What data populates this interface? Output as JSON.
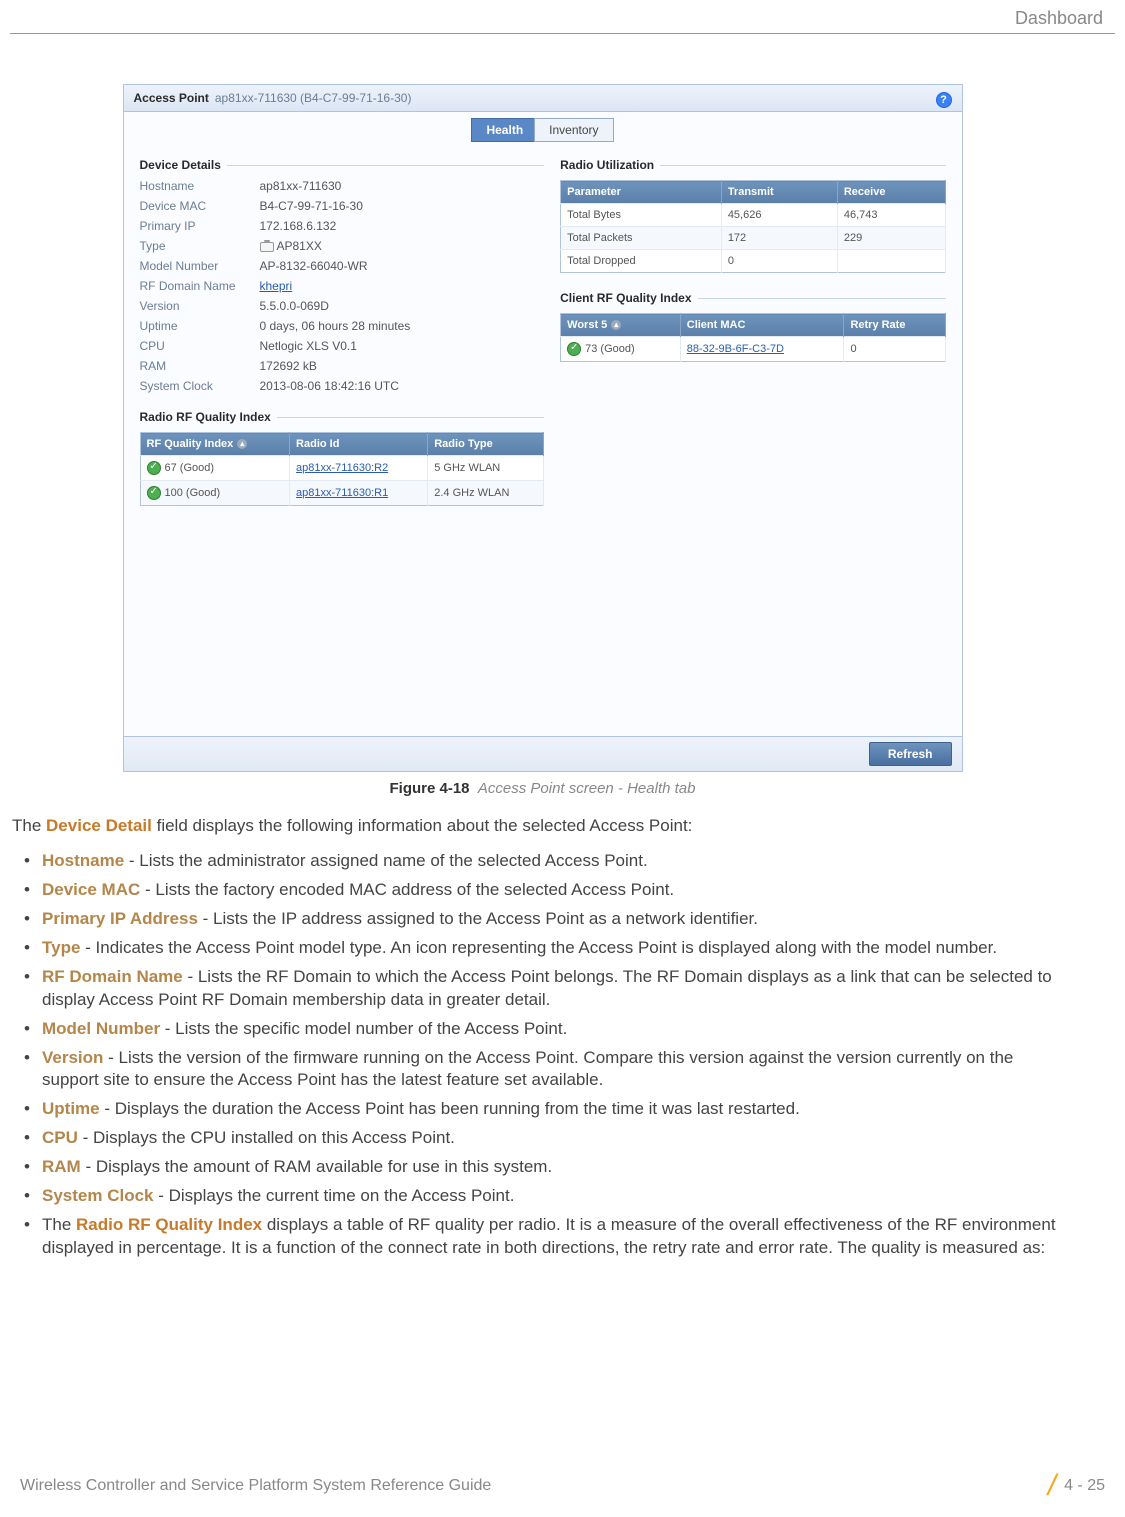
{
  "header_crumb": "Dashboard",
  "page_number": "4 - 25",
  "footer_text": "Wireless Controller and Service Platform System Reference Guide",
  "figure": {
    "num": "Figure 4-18",
    "caption": "Access Point screen - Health tab"
  },
  "panel": {
    "title": "Access Point",
    "subtitle": "ap81xx-711630 (B4-C7-99-71-16-30)",
    "tabs": {
      "health": "Health",
      "inventory": "Inventory"
    },
    "refresh": "Refresh",
    "device_details": {
      "legend": "Device Details",
      "rows": [
        {
          "k": "Hostname",
          "v": "ap81xx-711630"
        },
        {
          "k": "Device MAC",
          "v": "B4-C7-99-71-16-30"
        },
        {
          "k": "Primary IP",
          "v": "172.168.6.132"
        },
        {
          "k": "Type",
          "v": "AP81XX",
          "icon": true
        },
        {
          "k": "Model Number",
          "v": "AP-8132-66040-WR"
        },
        {
          "k": "RF Domain Name",
          "v": "khepri",
          "link": true
        },
        {
          "k": "Version",
          "v": "5.5.0.0-069D"
        },
        {
          "k": "Uptime",
          "v": "0 days, 06 hours 28 minutes"
        },
        {
          "k": "CPU",
          "v": "Netlogic XLS V0.1"
        },
        {
          "k": "RAM",
          "v": "172692 kB"
        },
        {
          "k": "System Clock",
          "v": "2013-08-06 18:42:16 UTC"
        }
      ]
    },
    "radio_rf_quality": {
      "legend": "Radio RF Quality Index",
      "headers": [
        "RF Quality Index",
        "Radio Id",
        "Radio Type"
      ],
      "rows": [
        {
          "q": "67 (Good)",
          "id": "ap81xx-711630:R2",
          "type": "5 GHz WLAN"
        },
        {
          "q": "100 (Good)",
          "id": "ap81xx-711630:R1",
          "type": "2.4 GHz WLAN"
        }
      ]
    },
    "radio_util": {
      "legend": "Radio Utilization",
      "headers": [
        "Parameter",
        "Transmit",
        "Receive"
      ],
      "rows": [
        {
          "p": "Total Bytes",
          "t": "45,626",
          "r": "46,743"
        },
        {
          "p": "Total Packets",
          "t": "172",
          "r": "229"
        },
        {
          "p": "Total Dropped",
          "t": "0",
          "r": ""
        }
      ]
    },
    "client_rf": {
      "legend": "Client RF Quality Index",
      "headers": [
        "Worst 5",
        "Client MAC",
        "Retry Rate"
      ],
      "rows": [
        {
          "w": "73 (Good)",
          "mac": "88-32-9B-6F-C3-7D",
          "r": "0"
        }
      ]
    }
  },
  "body": {
    "intro_pre": "The ",
    "intro_term": "Device Detail",
    "intro_post": " field displays the following information about the selected Access Point:",
    "items": [
      {
        "t": "Hostname",
        "d": " - Lists the administrator assigned name of the selected Access Point."
      },
      {
        "t": "Device MAC",
        "d": " - Lists the factory encoded MAC address of the selected Access Point."
      },
      {
        "t": "Primary IP Address",
        "d": " - Lists the IP address assigned to the Access Point as a network identifier."
      },
      {
        "t": "Type",
        "d": " - Indicates the Access Point model type. An icon representing the Access Point is displayed along with the model number."
      },
      {
        "t": "RF Domain Name",
        "d": " - Lists the RF Domain to which the Access Point belongs. The RF Domain displays as a link that can be selected to display Access Point RF Domain membership data in greater detail."
      },
      {
        "t": "Model Number",
        "d": " - Lists the specific model number of the Access Point."
      },
      {
        "t": "Version",
        "d": " - Lists the version of the firmware running on the Access Point. Compare this version against the version currently on the support site to ensure the Access Point has the latest feature set available."
      },
      {
        "t": "Uptime",
        "d": " - Displays the duration the Access Point has been running from the time it was last restarted."
      },
      {
        "t": "CPU",
        "d": " - Displays the CPU installed on this Access Point."
      },
      {
        "t": "RAM",
        "d": " - Displays the amount of RAM available for use in this system."
      },
      {
        "t": "System Clock",
        "d": " - Displays the current time on the Access Point."
      }
    ],
    "last_pre": "The ",
    "last_term": "Radio RF Quality Index",
    "last_post": " displays a table of RF quality per radio. It is a measure of the overall effectiveness of the RF environment displayed in percentage. It is a function of the connect rate in both directions, the retry rate and error rate. The quality is measured as:"
  }
}
